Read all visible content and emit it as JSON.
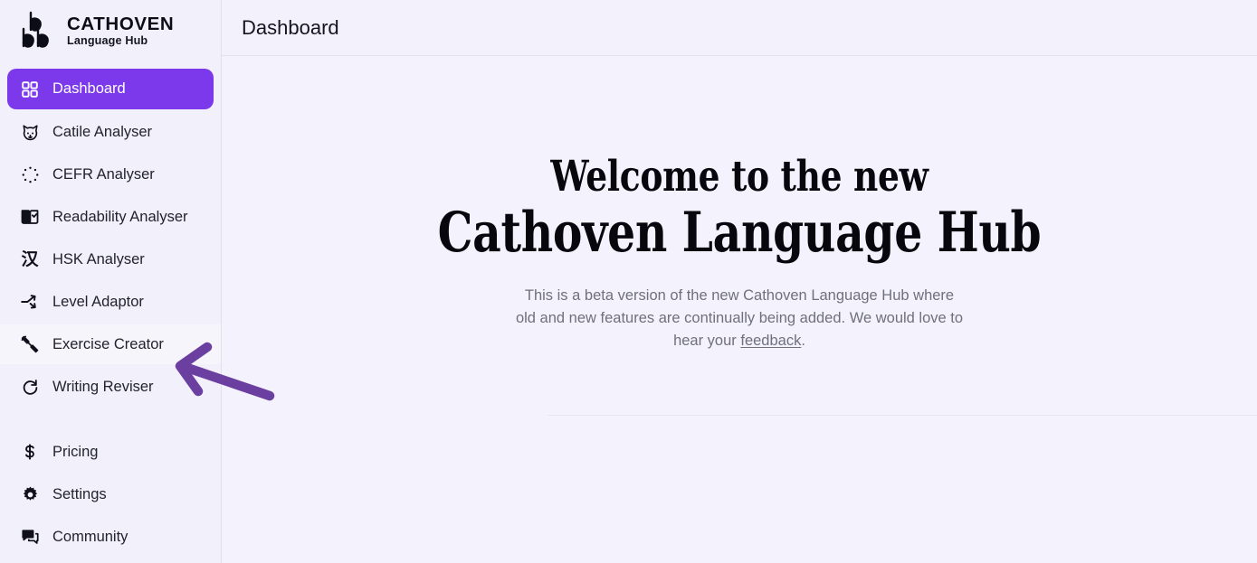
{
  "brand": {
    "logo_icon": "double-b-logo-icon",
    "title": "CATHOVEN",
    "subtitle": "Language Hub"
  },
  "header": {
    "title": "Dashboard"
  },
  "sidebar": {
    "main_items": [
      {
        "label": "Dashboard",
        "icon": "grid-icon",
        "state": "active"
      },
      {
        "label": "Catile Analyser",
        "icon": "cat-face-icon",
        "state": "default"
      },
      {
        "label": "CEFR Analyser",
        "icon": "eu-stars-icon",
        "state": "default"
      },
      {
        "label": "Readability Analyser",
        "icon": "open-book-icon",
        "state": "default"
      },
      {
        "label": "HSK Analyser",
        "icon": "hanzi-han-icon",
        "state": "default"
      },
      {
        "label": "Level Adaptor",
        "icon": "shuffle-arrows-icon",
        "state": "default"
      },
      {
        "label": "Exercise Creator",
        "icon": "dumbbell-icon",
        "state": "hovered"
      },
      {
        "label": "Writing Reviser",
        "icon": "rotate-refresh-icon",
        "state": "default"
      }
    ],
    "bottom_items": [
      {
        "label": "Pricing",
        "icon": "dollar-sign-icon"
      },
      {
        "label": "Settings",
        "icon": "gear-icon"
      },
      {
        "label": "Community",
        "icon": "chat-bubbles-icon"
      }
    ]
  },
  "main": {
    "welcome_line1": "Welcome to the new",
    "welcome_line2": "Cathoven Language Hub",
    "description_part1": "This is a beta version of the new Cathoven Language Hub where old and new features are continually being added. We would love to hear your ",
    "description_link": "feedback",
    "description_part2": "."
  },
  "annotation": {
    "type": "arrow",
    "points_to": "Exercise Creator",
    "direction": "left",
    "color": "#6b3fa0"
  },
  "colors": {
    "accent": "#7c39ec",
    "sidebar_bg": "#f1f0fb",
    "content_bg": "#f4f3fd",
    "annotation": "#6b3fa0",
    "text": "#23232f",
    "muted_text": "#6f6f7e"
  }
}
